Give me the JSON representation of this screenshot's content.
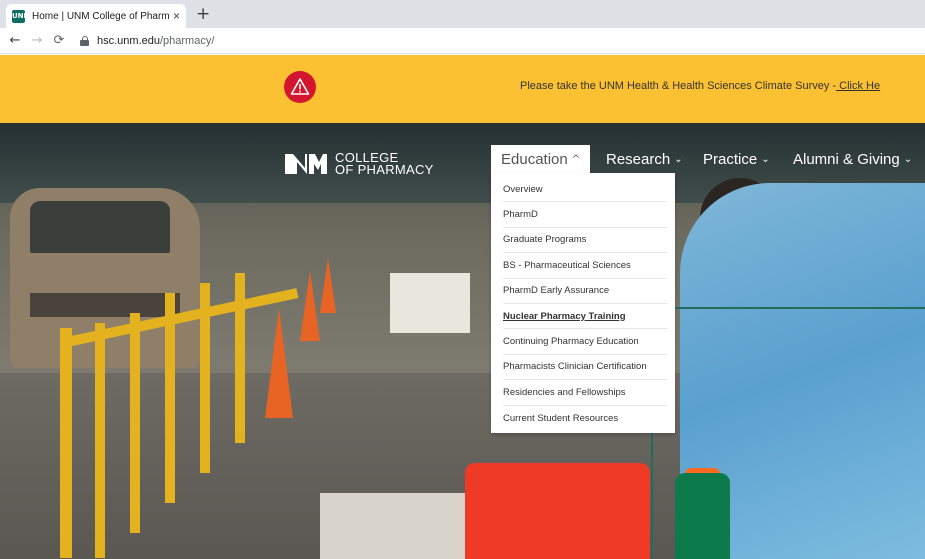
{
  "browser": {
    "tab_title": "Home | UNM College of Pharmac",
    "favicon_text": "UNM",
    "url_host": "hsc.unm.edu",
    "url_path": "/pharmacy/",
    "new_tab_symbol": "+",
    "close_symbol": "×"
  },
  "alert": {
    "text": "Please take the UNM Health & Health Sciences Climate Survey -",
    "link": " Click He",
    "icon": "warning-triangle-icon",
    "color": "#fcc133"
  },
  "site": {
    "logo_line1": "COLLEGE",
    "logo_line2": "OF PHARMACY"
  },
  "nav": {
    "items": [
      {
        "label": "Education",
        "chevron": "^"
      },
      {
        "label": "Research",
        "chevron": "⌄"
      },
      {
        "label": "Practice",
        "chevron": "⌄"
      },
      {
        "label": "Alumni & Giving",
        "chevron": "⌄"
      }
    ]
  },
  "dropdown": {
    "items": [
      "Overview",
      "PharmD",
      "Graduate Programs",
      "BS - Pharmaceutical Sciences",
      "PharmD Early Assurance",
      "Nuclear Pharmacy Training",
      "Continuing Pharmacy Education",
      "Pharmacists Clinician Certification",
      "Residencies and Fellowships",
      "Current Student Resources"
    ],
    "current": "Nuclear Pharmacy Training"
  }
}
